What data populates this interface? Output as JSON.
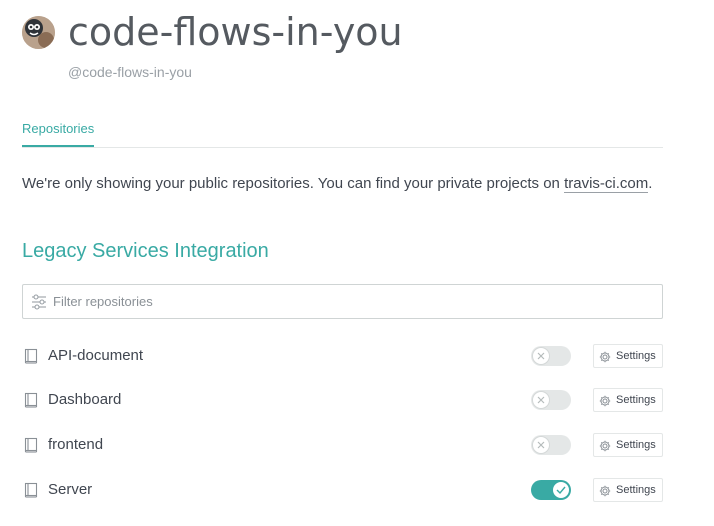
{
  "profile": {
    "name": "code-flows-in-you",
    "handle": "@code-flows-in-you"
  },
  "tabs": [
    {
      "label": "Repositories",
      "active": true
    }
  ],
  "notice": {
    "text": "We're only showing your public repositories. You can find your private projects on ",
    "link": "travis-ci.com",
    "suffix": "."
  },
  "section": {
    "title": "Legacy Services Integration"
  },
  "filter": {
    "placeholder": "Filter repositories"
  },
  "repos": [
    {
      "name": "API-document",
      "enabled": false,
      "settings_label": "Settings"
    },
    {
      "name": "Dashboard",
      "enabled": false,
      "settings_label": "Settings"
    },
    {
      "name": "frontend",
      "enabled": false,
      "settings_label": "Settings"
    },
    {
      "name": "Server",
      "enabled": true,
      "settings_label": "Settings"
    }
  ],
  "colors": {
    "accent": "#39aaa4",
    "text": "#404650",
    "muted": "#9aa0a6",
    "border": "#e4e7e7"
  },
  "icons": {
    "avatar": "avatar-image",
    "filter": "sliders-icon",
    "repo": "book-icon",
    "settings": "gear-icon",
    "toggle_off": "x-icon",
    "toggle_on": "check-icon"
  }
}
